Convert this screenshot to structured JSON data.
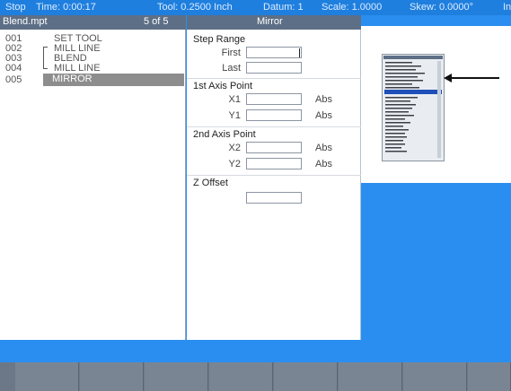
{
  "status": {
    "state": "Stop",
    "time": "Time: 0:00:17",
    "tool": "Tool: 0.2500 Inch",
    "datum": "Datum: 1",
    "scale": "Scale: 1.0000",
    "skew": "Skew: 0.0000°",
    "units": "In"
  },
  "program": {
    "filename": "Blend.mpt",
    "position": "5 of 5",
    "steps": [
      {
        "num": "001",
        "name": "SET TOOL"
      },
      {
        "num": "002",
        "name": "MILL LINE"
      },
      {
        "num": "003",
        "name": "BLEND"
      },
      {
        "num": "004",
        "name": "MILL LINE"
      },
      {
        "num": "005",
        "name": "MIRROR"
      }
    ],
    "selected_index": 4
  },
  "mirror_form": {
    "title": "Mirror",
    "step_range": {
      "title": "Step Range",
      "first_label": "First",
      "last_label": "Last",
      "first_value": "",
      "last_value": ""
    },
    "axis1": {
      "title": "1st Axis Point",
      "x_label": "X1",
      "y_label": "Y1",
      "x_mode": "Abs",
      "y_mode": "Abs",
      "x_value": "",
      "y_value": ""
    },
    "axis2": {
      "title": "2nd Axis Point",
      "x_label": "X2",
      "y_label": "Y2",
      "x_mode": "Abs",
      "y_mode": "Abs",
      "x_value": "",
      "y_value": ""
    },
    "z_offset": {
      "title": "Z Offset",
      "value": ""
    }
  },
  "softkeys": [
    "",
    "",
    "",
    "",
    "",
    "",
    "",
    ""
  ],
  "colors": {
    "background": "#2a8ef0",
    "header": "#5d6f86",
    "selection": "#8d8d8d",
    "softkey": "#7a8594"
  }
}
